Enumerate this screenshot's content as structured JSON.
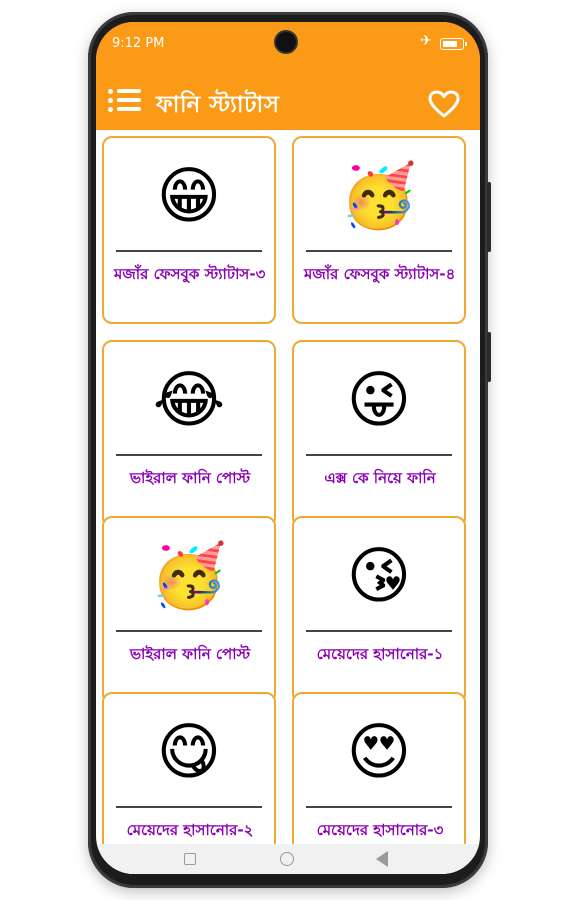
{
  "status_bar": {
    "time": "9:12 PM",
    "airplane_icon": "airplane-icon",
    "battery_icon": "battery-icon"
  },
  "app_bar": {
    "title": "ফানি স্ট্যাটাস",
    "menu_icon": "list-menu-icon",
    "favorite_icon": "heart-outline-icon",
    "color": "#fb9a16"
  },
  "cards": [
    {
      "emoji": "😁",
      "label": "মজাঁর ফেসবুক স্ট্যাটাস-৩"
    },
    {
      "emoji": "🥳",
      "label": "মজাঁর ফেসবুক স্ট্যাটাস-৪"
    },
    {
      "emoji": "😂",
      "label": "ভাইরাল ফানি পোস্ট"
    },
    {
      "emoji": "😜",
      "label": "এক্স কে নিয়ে ফানি"
    },
    {
      "emoji": "🥳",
      "label": "ভাইরাল ফানি পোস্ট"
    },
    {
      "emoji": "😘",
      "label": "মেয়েদের হাসানোর-১"
    },
    {
      "emoji": "😋",
      "label": "মেয়েদের হাসানোর-২"
    },
    {
      "emoji": "😍",
      "label": "মেয়েদের হাসানোর-৩"
    }
  ],
  "colors": {
    "card_border": "#f0a830",
    "label_text": "#8b00b3"
  }
}
